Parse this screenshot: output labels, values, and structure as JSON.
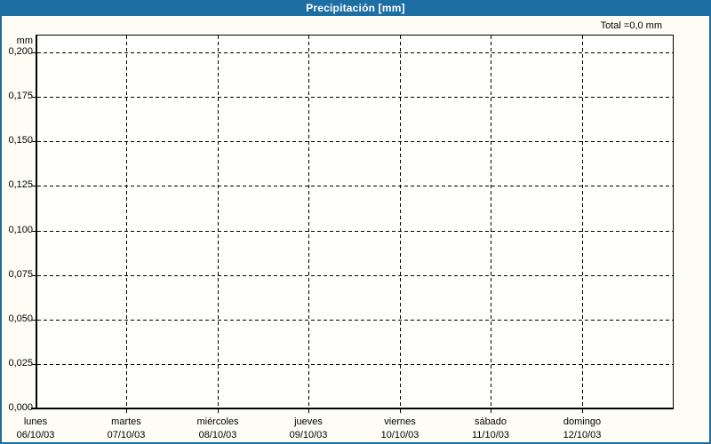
{
  "window": {
    "title": "Precipitación [mm]"
  },
  "chart": {
    "total_label": "Total =0,0 mm",
    "y_unit": "mm",
    "header_color": "#1d6fa3",
    "grid_color": "#000000",
    "background_outer": "#fdfdf6",
    "background_plot": "#fefefc"
  },
  "chart_data": {
    "type": "bar",
    "title": "Precipitación [mm]",
    "xlabel": "",
    "ylabel": "mm",
    "ylim": [
      0,
      0.21
    ],
    "grid": "dashed",
    "legend": "none",
    "annotations": [
      "Total =0,0 mm"
    ],
    "total_mm": 0.0,
    "yticks": [
      {
        "label": "0,200",
        "value": 0.2
      },
      {
        "label": "0,175",
        "value": 0.175
      },
      {
        "label": "0,150",
        "value": 0.15
      },
      {
        "label": "0,125",
        "value": 0.125
      },
      {
        "label": "0,100",
        "value": 0.1
      },
      {
        "label": "0,075",
        "value": 0.075
      },
      {
        "label": "0,050",
        "value": 0.05
      },
      {
        "label": "0,025",
        "value": 0.025
      },
      {
        "label": "0,000",
        "value": 0.0
      }
    ],
    "categories": [
      "lunes 06/10/03",
      "martes 07/10/03",
      "miércoles 08/10/03",
      "jueves 09/10/03",
      "viernes 10/10/03",
      "sábado 11/10/03",
      "domingo 12/10/03"
    ],
    "days": [
      {
        "name": "lunes",
        "date": "06/10/03"
      },
      {
        "name": "martes",
        "date": "07/10/03"
      },
      {
        "name": "miércoles",
        "date": "08/10/03"
      },
      {
        "name": "jueves",
        "date": "09/10/03"
      },
      {
        "name": "viernes",
        "date": "10/10/03"
      },
      {
        "name": "sábado",
        "date": "11/10/03"
      },
      {
        "name": "domingo",
        "date": "12/10/03"
      }
    ],
    "values": [
      0.0,
      0.0,
      0.0,
      0.0,
      0.0,
      0.0,
      0.0
    ]
  }
}
